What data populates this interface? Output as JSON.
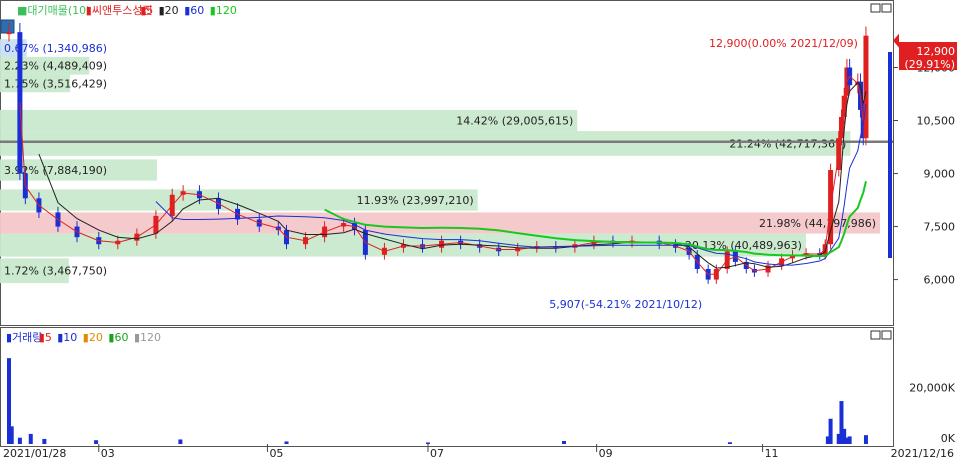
{
  "price_panel": {
    "legend": [
      {
        "label": "■대기매물(10)",
        "color": "#3bbf5c"
      },
      {
        "label": "▮씨앤투스성진",
        "color": "#e02020"
      },
      {
        "label": "▮5",
        "color": "#e02020"
      },
      {
        "label": "▮20",
        "color": "#222222"
      },
      {
        "label": "▮60",
        "color": "#1b2fd6"
      },
      {
        "label": "▮120",
        "color": "#19c81e"
      }
    ],
    "high_annotation": "12,900(0.00% 2021/12/09)",
    "low_annotation": "5,907(-54.21% 2021/10/12)",
    "last_price_tag": {
      "price": "12,900",
      "change": "(29.91%)"
    }
  },
  "volume_panel": {
    "legend": [
      {
        "label": "▮거래량",
        "color": "#1b2fd6"
      },
      {
        "label": "▮5",
        "color": "#e02020"
      },
      {
        "label": "▮10",
        "color": "#1b2fd6"
      },
      {
        "label": "▮20",
        "color": "#e08a00"
      },
      {
        "label": "▮60",
        "color": "#19a01e"
      },
      {
        "label": "▮120",
        "color": "#999999"
      }
    ]
  },
  "date_axis": {
    "start": "2021/01/28",
    "end": "2021/12/16"
  },
  "chart_data": [
    {
      "type": "candlestick",
      "title": "씨앤투스성진",
      "ylim": [
        4800,
        13400
      ],
      "y_ticks": [
        6000,
        7500,
        9000,
        10500,
        12000
      ],
      "y_tick_labels": [
        "6,000",
        "7,500",
        "9,000",
        "10,500",
        "12,000"
      ],
      "x_ticks": [
        "03",
        "05",
        "07",
        "09",
        "11"
      ],
      "close_series": [
        {
          "date": "2021-01-28",
          "close": 13000
        },
        {
          "date": "2021-02-01",
          "close": 9000
        },
        {
          "date": "2021-02-03",
          "close": 8300
        },
        {
          "date": "2021-02-08",
          "close": 7900
        },
        {
          "date": "2021-02-15",
          "close": 7500
        },
        {
          "date": "2021-02-22",
          "close": 7200
        },
        {
          "date": "2021-03-02",
          "close": 7000
        },
        {
          "date": "2021-03-09",
          "close": 7100
        },
        {
          "date": "2021-03-16",
          "close": 7300
        },
        {
          "date": "2021-03-23",
          "close": 7800
        },
        {
          "date": "2021-03-29",
          "close": 8400
        },
        {
          "date": "2021-04-02",
          "close": 8500
        },
        {
          "date": "2021-04-08",
          "close": 8300
        },
        {
          "date": "2021-04-15",
          "close": 8000
        },
        {
          "date": "2021-04-22",
          "close": 7700
        },
        {
          "date": "2021-04-30",
          "close": 7500
        },
        {
          "date": "2021-05-07",
          "close": 7400
        },
        {
          "date": "2021-05-10",
          "close": 7000
        },
        {
          "date": "2021-05-17",
          "close": 7200
        },
        {
          "date": "2021-05-24",
          "close": 7500
        },
        {
          "date": "2021-05-31",
          "close": 7600
        },
        {
          "date": "2021-06-04",
          "close": 7400
        },
        {
          "date": "2021-06-08",
          "close": 6700
        },
        {
          "date": "2021-06-15",
          "close": 6900
        },
        {
          "date": "2021-06-22",
          "close": 7000
        },
        {
          "date": "2021-06-29",
          "close": 6900
        },
        {
          "date": "2021-07-06",
          "close": 7100
        },
        {
          "date": "2021-07-13",
          "close": 7000
        },
        {
          "date": "2021-07-20",
          "close": 6900
        },
        {
          "date": "2021-07-27",
          "close": 6800
        },
        {
          "date": "2021-08-03",
          "close": 6900
        },
        {
          "date": "2021-08-10",
          "close": 6950
        },
        {
          "date": "2021-08-17",
          "close": 6900
        },
        {
          "date": "2021-08-24",
          "close": 7000
        },
        {
          "date": "2021-08-31",
          "close": 7100
        },
        {
          "date": "2021-09-07",
          "close": 7050
        },
        {
          "date": "2021-09-14",
          "close": 7100
        },
        {
          "date": "2021-09-24",
          "close": 7000
        },
        {
          "date": "2021-09-30",
          "close": 6900
        },
        {
          "date": "2021-10-05",
          "close": 6700
        },
        {
          "date": "2021-10-08",
          "close": 6300
        },
        {
          "date": "2021-10-12",
          "close": 6000
        },
        {
          "date": "2021-10-15",
          "close": 6300
        },
        {
          "date": "2021-10-19",
          "close": 6800
        },
        {
          "date": "2021-10-22",
          "close": 6500
        },
        {
          "date": "2021-10-26",
          "close": 6300
        },
        {
          "date": "2021-10-29",
          "close": 6200
        },
        {
          "date": "2021-11-03",
          "close": 6400
        },
        {
          "date": "2021-11-08",
          "close": 6600
        },
        {
          "date": "2021-11-12",
          "close": 6700
        },
        {
          "date": "2021-11-17",
          "close": 6750
        },
        {
          "date": "2021-11-22",
          "close": 6700
        },
        {
          "date": "2021-11-24",
          "close": 7000
        },
        {
          "date": "2021-11-26",
          "close": 9100
        },
        {
          "date": "2021-11-29",
          "close": 10000
        },
        {
          "date": "2021-11-30",
          "close": 10600
        },
        {
          "date": "2021-12-01",
          "close": 11200
        },
        {
          "date": "2021-12-02",
          "close": 12000
        },
        {
          "date": "2021-12-03",
          "close": 11500
        },
        {
          "date": "2021-12-06",
          "close": 11600
        },
        {
          "date": "2021-12-07",
          "close": 10800
        },
        {
          "date": "2021-12-08",
          "close": 10000
        },
        {
          "date": "2021-12-09",
          "close": 12900
        }
      ],
      "annotations": [
        {
          "text": "12,900(0.00% 2021/12/09)",
          "price": 12900
        },
        {
          "text": "5,907(-54.21% 2021/10/12)",
          "price": 5907
        }
      ],
      "current_price": {
        "label": "12,900",
        "change": "(29.91%)",
        "value": 12900
      },
      "reference_line": 9900
    },
    {
      "type": "horizontal-bar",
      "title": "대기매물(10)",
      "series": [
        {
          "label": "0.67% (1,340,986)",
          "percent": 0.67,
          "volume": 1340986,
          "price_low": 12300,
          "price_high": 12800,
          "color": "blue"
        },
        {
          "label": "2.23% (4,489,409)",
          "percent": 2.23,
          "volume": 4489409,
          "price_low": 11800,
          "price_high": 12300,
          "color": "green"
        },
        {
          "label": "1.75% (3,516,429)",
          "percent": 1.75,
          "volume": 3516429,
          "price_low": 11300,
          "price_high": 11800,
          "color": "green"
        },
        {
          "label": "14.42% (29,005,615)",
          "percent": 14.42,
          "volume": 29005615,
          "price_low": 10200,
          "price_high": 10800,
          "color": "green"
        },
        {
          "label": "21.24% (42,717,367)",
          "percent": 21.24,
          "volume": 42717367,
          "price_low": 9500,
          "price_high": 10200,
          "color": "green"
        },
        {
          "label": "3.92% (7,884,190)",
          "percent": 3.92,
          "volume": 7884190,
          "price_low": 8800,
          "price_high": 9400,
          "color": "green"
        },
        {
          "label": "11.93% (23,997,210)",
          "percent": 11.93,
          "volume": 23997210,
          "price_low": 7950,
          "price_high": 8550,
          "color": "green"
        },
        {
          "label": "21.98% (44,197,986)",
          "percent": 21.98,
          "volume": 44197986,
          "price_low": 7300,
          "price_high": 7900,
          "color": "red"
        },
        {
          "label": "20.13% (40,489,963)",
          "percent": 20.13,
          "volume": 40489963,
          "price_low": 6650,
          "price_high": 7300,
          "color": "green"
        },
        {
          "label": "1.72% (3,467,750)",
          "percent": 1.72,
          "volume": 3467750,
          "price_low": 5900,
          "price_high": 6600,
          "color": "green"
        }
      ]
    },
    {
      "type": "bar",
      "title": "거래량",
      "ylim": [
        0,
        40000
      ],
      "y_ticks": [
        0,
        20000
      ],
      "y_tick_labels": [
        "0K",
        "20,000K"
      ],
      "values_k": [
        {
          "date": "2021-01-28",
          "volume_k": 34000
        },
        {
          "date": "2021-01-29",
          "volume_k": 7000
        },
        {
          "date": "2021-02-01",
          "volume_k": 2500
        },
        {
          "date": "2021-02-05",
          "volume_k": 4000
        },
        {
          "date": "2021-02-10",
          "volume_k": 2000
        },
        {
          "date": "2021-03-01",
          "volume_k": 1500
        },
        {
          "date": "2021-04-01",
          "volume_k": 1800
        },
        {
          "date": "2021-05-10",
          "volume_k": 1000
        },
        {
          "date": "2021-07-01",
          "volume_k": 600
        },
        {
          "date": "2021-08-20",
          "volume_k": 1200
        },
        {
          "date": "2021-10-20",
          "volume_k": 700
        },
        {
          "date": "2021-11-25",
          "volume_k": 3000
        },
        {
          "date": "2021-11-26",
          "volume_k": 10000
        },
        {
          "date": "2021-11-29",
          "volume_k": 4000
        },
        {
          "date": "2021-11-30",
          "volume_k": 17000
        },
        {
          "date": "2021-12-01",
          "volume_k": 6000
        },
        {
          "date": "2021-12-02",
          "volume_k": 2500
        },
        {
          "date": "2021-12-03",
          "volume_k": 3000
        },
        {
          "date": "2021-12-09",
          "volume_k": 3500
        }
      ]
    }
  ]
}
